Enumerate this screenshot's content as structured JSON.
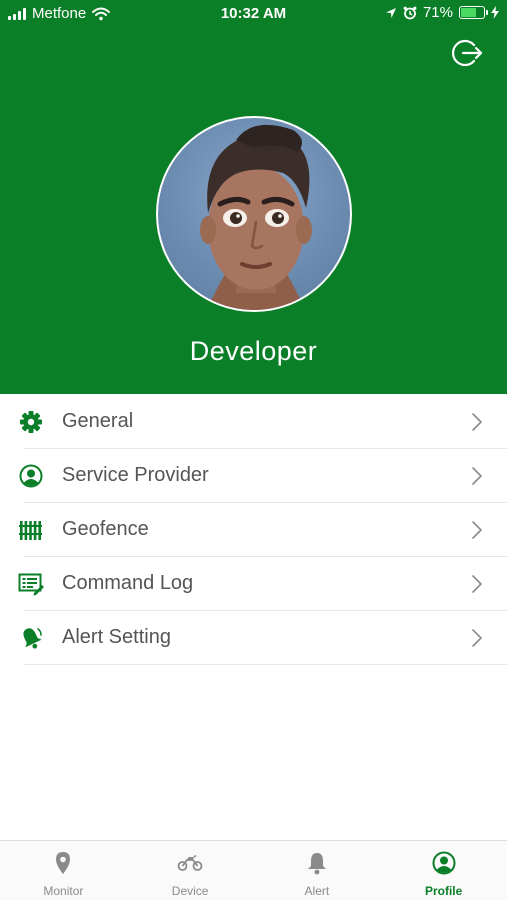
{
  "status_bar": {
    "carrier": "Metfone",
    "time": "10:32 AM",
    "battery_percent": "71%",
    "battery_level": 0.71
  },
  "header": {
    "background_color": "#0a7f28",
    "logout_icon": "logout-icon",
    "user_name": "Developer",
    "avatar_icon": "user-avatar"
  },
  "menu": {
    "items": [
      {
        "label": "General",
        "icon": "gear-icon"
      },
      {
        "label": "Service Provider",
        "icon": "user-circle-icon"
      },
      {
        "label": "Geofence",
        "icon": "fence-icon"
      },
      {
        "label": "Command Log",
        "icon": "log-icon"
      },
      {
        "label": "Alert Setting",
        "icon": "bell-icon"
      }
    ]
  },
  "tabbar": {
    "accent_color": "#0a7f28",
    "inactive_color": "#8a8a8a",
    "tabs": [
      {
        "label": "Monitor",
        "icon": "location-pin-icon",
        "active": false
      },
      {
        "label": "Device",
        "icon": "motorbike-icon",
        "active": false
      },
      {
        "label": "Alert",
        "icon": "bell-icon",
        "active": false
      },
      {
        "label": "Profile",
        "icon": "user-circle-icon",
        "active": true
      }
    ]
  }
}
